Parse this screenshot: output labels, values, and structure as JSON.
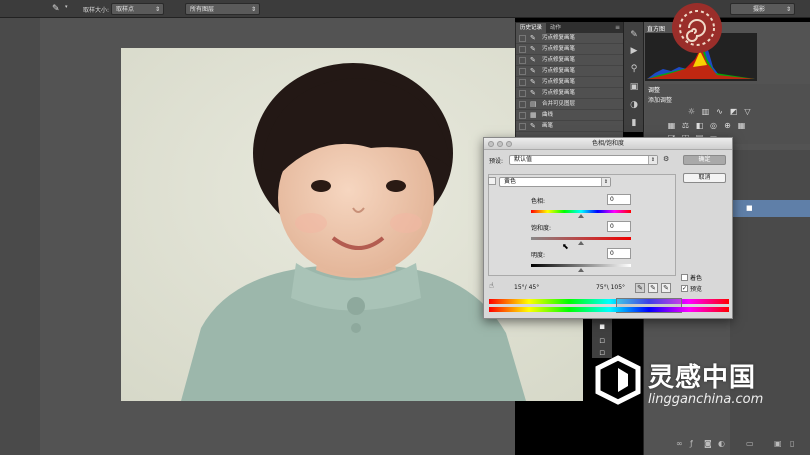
{
  "options_bar": {
    "tool_icon": "eyedropper-icon",
    "sample_size_label": "取样大小:",
    "sample_size_value": "取样点",
    "sample_layers_value": "所有图层",
    "workspace_value": "摄影"
  },
  "history_panel": {
    "tabs": [
      "历史记录",
      "动作"
    ],
    "items": [
      "污点修复画笔",
      "污点修复画笔",
      "污点修复画笔",
      "污点修复画笔",
      "污点修复画笔",
      "污点修复画笔",
      "合并可见图层",
      "曲线",
      "画笔"
    ]
  },
  "right_panels": {
    "histogram_tab": "直方图",
    "adjustments_tab": "调整",
    "adjustments_subtitle": "添加调整"
  },
  "dialog": {
    "title": "色相/饱和度",
    "preset_label": "预设:",
    "preset_value": "默认值",
    "ok_label": "确定",
    "cancel_label": "取消",
    "channel_value": "黄色",
    "hue_label": "色相:",
    "hue_value": "0",
    "saturation_label": "饱和度:",
    "saturation_value": "0",
    "lightness_label": "明度:",
    "lightness_value": "0",
    "range_left": "15°/ 45°",
    "range_right": "75°\\ 105°",
    "colorize_label": "着色",
    "colorize_checked": false,
    "preview_label": "预览",
    "preview_checked": true
  },
  "watermark": {
    "brand": "灵感中国",
    "url": "lingganchina.com"
  },
  "colors": {
    "accent_selected_layer": "#5f7fa8",
    "logo_red": "#9a2e2a"
  }
}
